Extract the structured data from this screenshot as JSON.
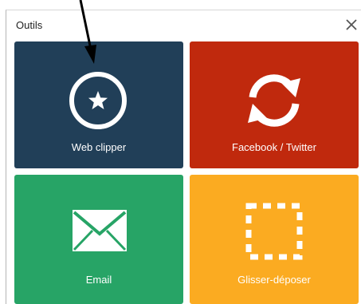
{
  "dialog": {
    "title": "Outils"
  },
  "tiles": [
    {
      "label": "Web clipper",
      "color": "#213f58",
      "icon": "star-in-circle-icon"
    },
    {
      "label": "Facebook / Twitter",
      "color": "#c0290d",
      "icon": "refresh-sync-icon"
    },
    {
      "label": "Email",
      "color": "#27a466",
      "icon": "envelope-icon"
    },
    {
      "label": "Glisser-déposer",
      "color": "#fbab21",
      "icon": "dashed-selection-icon"
    }
  ],
  "icons": {
    "close": "close-icon",
    "annotation": "arrow-pointer-icon"
  }
}
